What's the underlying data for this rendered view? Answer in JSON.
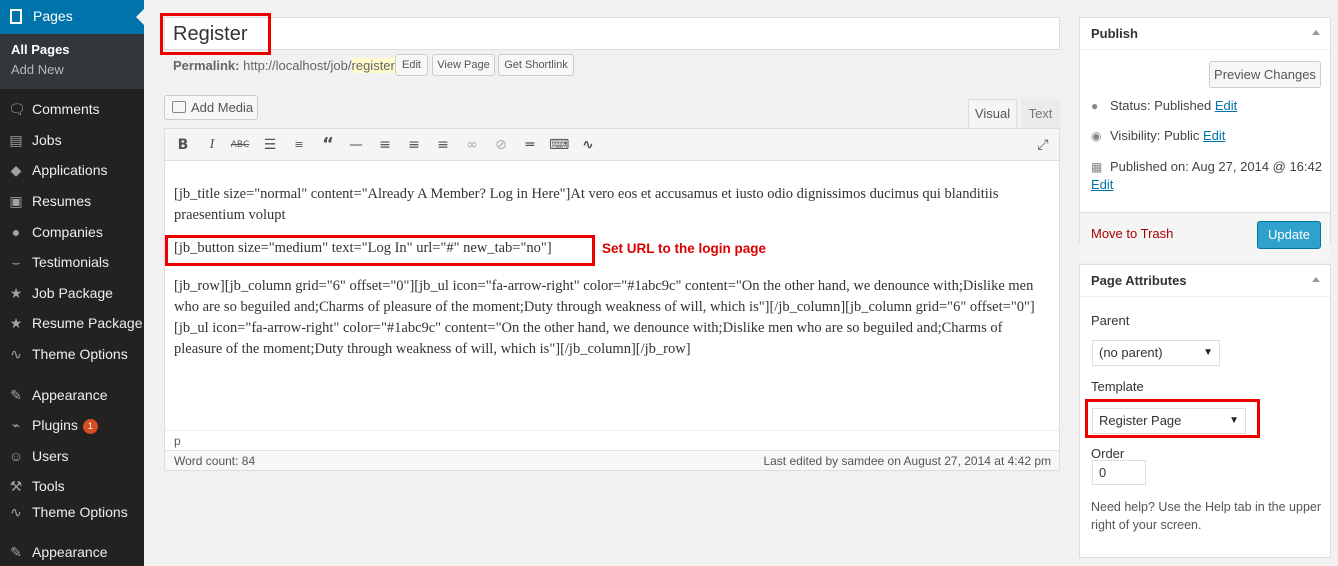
{
  "sidebar": {
    "current": "Pages",
    "submenu": [
      "All Pages",
      "Add New"
    ],
    "items": [
      {
        "label": "Comments",
        "icon": "comment-icon"
      },
      {
        "label": "Jobs",
        "icon": "folder-icon"
      },
      {
        "label": "Applications",
        "icon": "tag-icon"
      },
      {
        "label": "Resumes",
        "icon": "id-card-icon"
      },
      {
        "label": "Companies",
        "icon": "group-icon"
      },
      {
        "label": "Testimonials",
        "icon": "smile-icon"
      },
      {
        "label": "Job Package",
        "icon": "star-icon"
      },
      {
        "label": "Resume Package",
        "icon": "star-icon"
      },
      {
        "label": "Theme Options",
        "icon": "wave-icon"
      },
      {
        "label": "Appearance",
        "icon": "brush-icon"
      },
      {
        "label": "Plugins",
        "icon": "plug-icon",
        "badge": "1"
      },
      {
        "label": "Users",
        "icon": "user-icon"
      },
      {
        "label": "Tools",
        "icon": "wrench-icon"
      },
      {
        "label": "Theme Options",
        "icon": "wave-icon"
      },
      {
        "label": "Appearance",
        "icon": "brush-icon"
      }
    ]
  },
  "editor": {
    "title": "Register",
    "permalink_label": "Permalink:",
    "permalink_base": "http://localhost/job/",
    "permalink_slug": "register",
    "permalink_end": "/",
    "edit_btn": "Edit",
    "view_btn": "View Page",
    "shortlink_btn": "Get Shortlink",
    "add_media": "Add Media",
    "tab_visual": "Visual",
    "tab_text": "Text",
    "paragraph1": "[jb_title size=\"normal\" content=\"Already A Member? Log in Here\"]At vero eos et accusamus et iusto odio dignissimos ducimus qui blanditiis praesentium volupt",
    "button_shortcode": "[jb_button size=\"medium\" text=\"Log In\" url=\"#\" new_tab=\"no\"]",
    "annotation": "Set URL to the login page",
    "paragraph3": "[jb_row][jb_column grid=\"6\" offset=\"0\"][jb_ul icon=\"fa-arrow-right\" color=\"#1abc9c\" content=\"On the other hand, we denounce with;Dislike men who are so beguiled and;Charms of pleasure of the moment;Duty through weakness of will, which is\"][/jb_column][jb_column grid=\"6\" offset=\"0\"][jb_ul icon=\"fa-arrow-right\" color=\"#1abc9c\" content=\"On the other hand, we denounce with;Dislike men who are so beguiled and;Charms of pleasure of the moment;Duty through weakness of will, which is\"][/jb_column][/jb_row]",
    "path": "p",
    "word_count": "Word count: 84",
    "last_edited": "Last edited by samdee on August 27, 2014 at 4:42 pm"
  },
  "publish": {
    "heading": "Publish",
    "preview": "Preview Changes",
    "status_label": "Status:",
    "status_value": "Published",
    "visibility_label": "Visibility:",
    "visibility_value": "Public",
    "published_label": "Published on:",
    "published_value": "Aug 27, 2014 @ 16:42",
    "edit": "Edit",
    "trash": "Move to Trash",
    "update": "Update"
  },
  "attributes": {
    "heading": "Page Attributes",
    "parent_label": "Parent",
    "parent_value": "(no parent)",
    "template_label": "Template",
    "template_value": "Register Page",
    "order_label": "Order",
    "order_value": "0",
    "help": "Need help? Use the Help tab in the upper right of your screen."
  },
  "colors": {
    "accent": "#0073aa",
    "annotation": "#dd0000",
    "update": "#2ea2cc"
  }
}
